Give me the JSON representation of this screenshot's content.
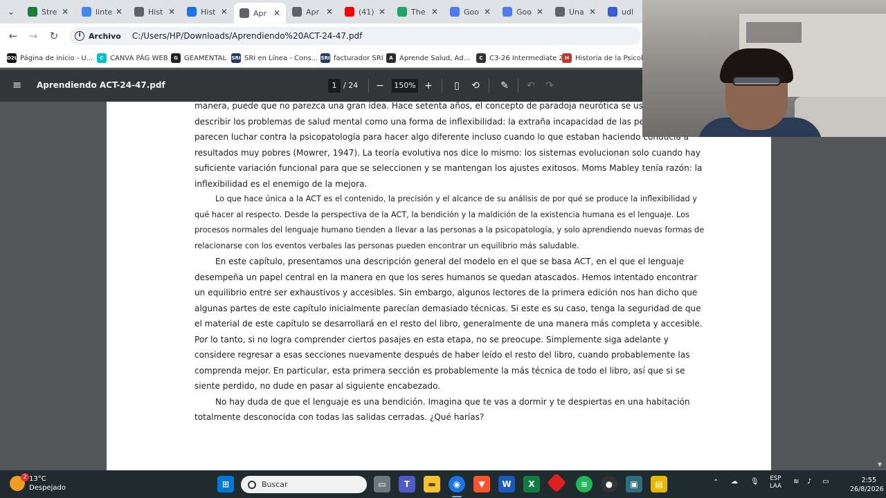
{
  "tabs": [
    {
      "label": "Stre",
      "icon": "k-icon",
      "color": "#1b7c3a"
    },
    {
      "label": "linte",
      "icon": "google-icon",
      "color": "#4285f4"
    },
    {
      "label": "Hist",
      "icon": "history-icon",
      "color": "#5f6368"
    },
    {
      "label": "Hist",
      "icon": "download-icon",
      "color": "#1a73e8"
    },
    {
      "label": "Apr",
      "icon": "globe-icon",
      "color": "#5f6368",
      "active": true
    },
    {
      "label": "Apr",
      "icon": "globe-icon",
      "color": "#5f6368"
    },
    {
      "label": "(41)",
      "icon": "youtube-icon",
      "color": "#ff0000"
    },
    {
      "label": "The",
      "icon": "drive-icon",
      "color": "#1fa463"
    },
    {
      "label": "Goo",
      "icon": "gemini-icon",
      "color": "#4f7bef"
    },
    {
      "label": "Goo",
      "icon": "gemini-icon",
      "color": "#4f7bef"
    },
    {
      "label": "Una",
      "icon": "globe-icon",
      "color": "#5f6368"
    },
    {
      "label": "udl",
      "icon": "udla-icon",
      "color": "#3b5bdb"
    }
  ],
  "address": {
    "chip": "Archivo",
    "url": "C:/Users/HP/Downloads/Aprendiendo%20ACT-24-47.pdf"
  },
  "bookmarks": [
    {
      "label": "Página de inicio - U...",
      "icon": "D2L",
      "color": "#111111"
    },
    {
      "label": "CANVA PÁG WEB",
      "icon": "C",
      "color": "#00c4cc"
    },
    {
      "label": "GEAMENTAL",
      "icon": "G",
      "color": "#222222"
    },
    {
      "label": "SRI en Línea - Cons...",
      "icon": "SRI",
      "color": "#1e3a6e"
    },
    {
      "label": "facturador SRI",
      "icon": "SRI",
      "color": "#1e3a6e"
    },
    {
      "label": "Aprende Salud, Ad...",
      "icon": "A",
      "color": "#2c2c2c"
    },
    {
      "label": "C3-26 Intermediate 2",
      "icon": "C",
      "color": "#333333"
    },
    {
      "label": "Historia de la Psicol...",
      "icon": "H",
      "color": "#c0392b"
    }
  ],
  "pdf": {
    "title": "Aprendiendo ACT-24-47.pdf",
    "page": "1",
    "total": "/ 24",
    "zoom": "150%"
  },
  "document": {
    "paragraphs": [
      {
        "text": "manera, puede que no parezca una gran idea. Hace setenta años, el concepto de paradoja neurótica se usó para describir los problemas de salud mental como una forma de inflexibilidad: la extraña incapacidad de las personas que parecen luchar contra la psicopatología para hacer algo diferente incluso cuando lo que estaban haciendo conducía a resultados muy pobres (Mowrer, 1947). La teoría evolutiva nos dice lo mismo: los sistemas evolucionan solo cuando hay suficiente variación funcional para que se seleccionen y se mantengan los ajustes exitosos. Moms Mabley tenía razón: la inflexibilidad es el enemigo de la mejora.",
        "indent": false,
        "small": false
      },
      {
        "text": "Lo que hace única a la ACT es el contenido, la precisión y el alcance de su análisis de por qué se produce la inflexibilidad y qué hacer al respecto. Desde la perspectiva de la ACT, la bendición y la maldición de la existencia humana es el lenguaje. Los procesos normales del lenguaje humano tienden a llevar a las personas a la psicopatología, y solo aprendiendo nuevas formas de relacionarse con los eventos verbales las personas pueden encontrar un equilibrio más saludable.",
        "indent": true,
        "small": true
      },
      {
        "text": "En este capítulo, presentamos una descripción general del modelo en el que se basa ACT, en el que el lenguaje desempeña un papel central en la manera en que los seres humanos se quedan atascados. Hemos intentado encontrar un equilibrio entre ser exhaustivos y accesibles. Sin embargo, algunos lectores de la primera edición nos han dicho que algunas partes de este capítulo inicialmente parecían demasiado técnicas. Si este es su caso, tenga la seguridad de que el material de este capítulo se desarrollará en el resto del libro, generalmente de una manera más completa y accesible. Por lo tanto, si no logra comprender ciertos pasajes en esta etapa, no se preocupe. Simplemente siga adelante y considere regresar a esas secciones nuevamente después de haber leído el resto del libro, cuando probablemente las comprenda mejor. En particular, esta primera sección es probablemente la más técnica de todo el libro, así que si se siente perdido, no dude en pasar al siguiente encabezado.",
        "indent": true,
        "small": false
      },
      {
        "text": "No hay duda de que el lenguaje es una bendición. Imagina que te vas a dormir y te despiertas en una habitación totalmente desconocida con todas las salidas cerradas. ¿Qué harías?",
        "indent": true,
        "small": false
      }
    ]
  },
  "taskbar": {
    "temp": "13°C",
    "weather": "Despejado",
    "weather_badge": "2",
    "search_placeholder": "Buscar",
    "lang1": "ESP",
    "lang2": "LAA",
    "time": "2:55",
    "date": "26/8/2026"
  }
}
